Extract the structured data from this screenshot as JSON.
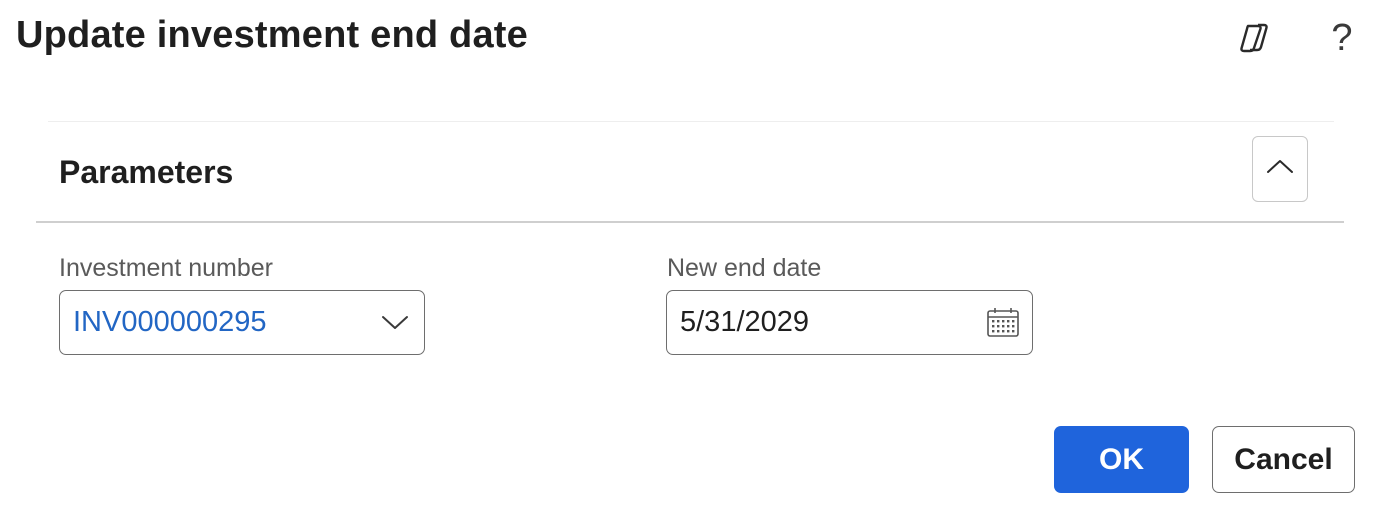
{
  "dialog": {
    "title": "Update investment end date",
    "help_label": "?",
    "icons": {
      "copilot": "copilot-icon",
      "help": "help-icon"
    }
  },
  "section": {
    "title": "Parameters",
    "collapse_icon": "chevron-up-icon"
  },
  "fields": {
    "investment_number": {
      "label": "Investment number",
      "value": "INV000000295",
      "icon": "chevron-down-icon"
    },
    "new_end_date": {
      "label": "New end date",
      "value": "5/31/2029",
      "icon": "calendar-icon"
    }
  },
  "buttons": {
    "ok": "OK",
    "cancel": "Cancel"
  },
  "colors": {
    "primary": "#1f64dc",
    "link": "#2266c4",
    "text": "#1f1f1f",
    "label": "#5a5a5a",
    "border": "#6e6e6e"
  }
}
